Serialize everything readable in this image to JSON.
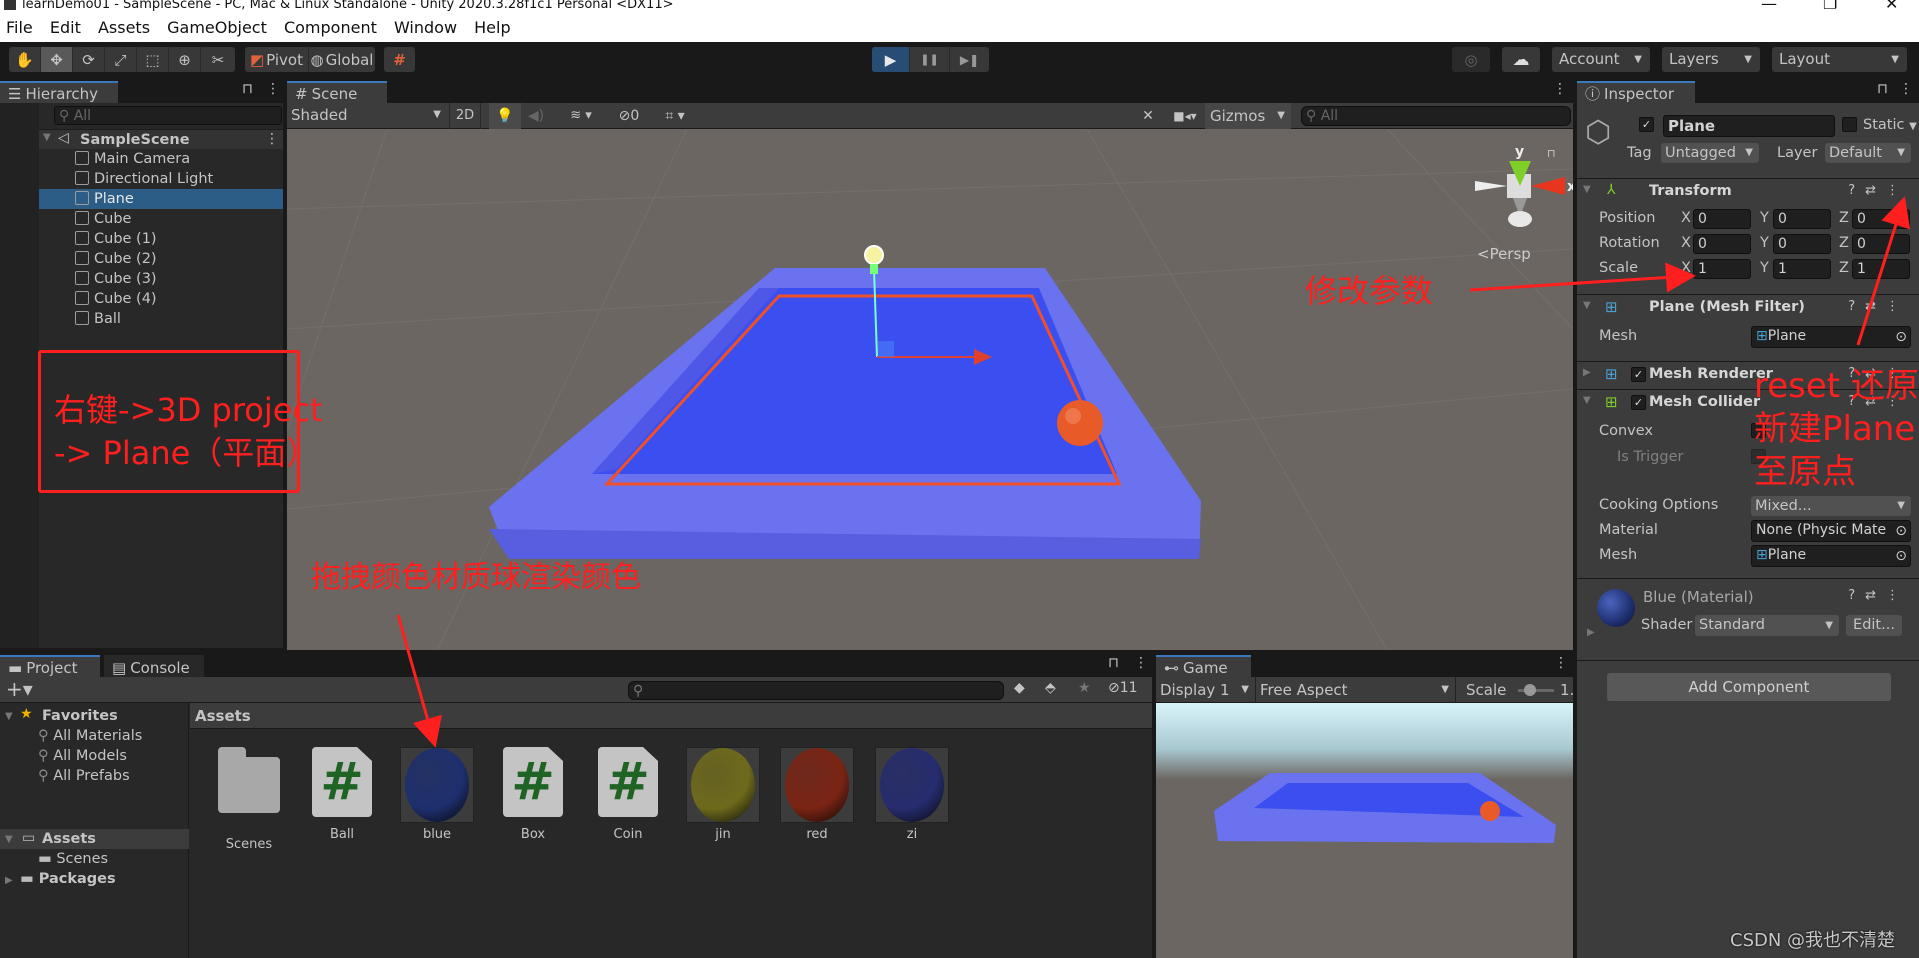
{
  "window": {
    "title": "learnDemo01 - SampleScene - PC, Mac & Linux Standalone - Unity 2020.3.28f1c1 Personal <DX11>",
    "controls": {
      "minimize": "—",
      "maximize": "❐",
      "close": "✕"
    }
  },
  "menu": [
    "File",
    "Edit",
    "Assets",
    "GameObject",
    "Component",
    "Window",
    "Help"
  ],
  "toolbar": {
    "tools": [
      {
        "name": "hand-tool",
        "glyph": "✋"
      },
      {
        "name": "move-tool",
        "glyph": "✥",
        "active": true
      },
      {
        "name": "rotate-tool",
        "glyph": "⟳"
      },
      {
        "name": "scale-tool",
        "glyph": "⤢"
      },
      {
        "name": "rect-tool",
        "glyph": "⬚"
      },
      {
        "name": "transform-tool",
        "glyph": "⊕"
      },
      {
        "name": "custom-tool",
        "glyph": "✂"
      }
    ],
    "pivot": "Pivot",
    "global": "Global",
    "snap_glyph": "#",
    "play": "▶",
    "pause": "❚❚",
    "step": "▶❚",
    "collab_glyph": "◎",
    "cloud_glyph": "☁",
    "account": "Account",
    "layers": "Layers",
    "layout": "Layout"
  },
  "hierarchy": {
    "tab": "Hierarchy",
    "search_placeholder": "All",
    "scene": "SampleScene",
    "items": [
      "Main Camera",
      "Directional Light",
      "Plane",
      "Cube",
      "Cube (1)",
      "Cube (2)",
      "Cube (3)",
      "Cube (4)",
      "Ball"
    ],
    "selected": "Plane"
  },
  "scene": {
    "tab": "Scene",
    "shading": "Shaded",
    "mode2d": "2D",
    "hidden_count": "0",
    "gizmos": "Gizmos",
    "search_placeholder": "All",
    "persp": "<Persp",
    "axis_x": "x",
    "axis_y": "y"
  },
  "inspector": {
    "tab": "Inspector",
    "object_name": "Plane",
    "static": "Static",
    "tag_label": "Tag",
    "tag": "Untagged",
    "layer_label": "Layer",
    "layer": "Default",
    "transform": {
      "title": "Transform",
      "rows": [
        {
          "label": "Position",
          "x": "0",
          "y": "0",
          "z": "0"
        },
        {
          "label": "Rotation",
          "x": "0",
          "y": "0",
          "z": "0"
        },
        {
          "label": "Scale",
          "x": "1",
          "y": "1",
          "z": "1"
        }
      ]
    },
    "mesh_filter": {
      "title": "Plane (Mesh Filter)",
      "mesh_label": "Mesh",
      "mesh": "Plane"
    },
    "mesh_renderer": {
      "title": "Mesh Renderer"
    },
    "mesh_collider": {
      "title": "Mesh Collider",
      "convex": "Convex",
      "is_trigger": "Is Trigger",
      "cooking_label": "Cooking Options",
      "cooking": "Mixed...",
      "material_label": "Material",
      "material": "None (Physic Mate",
      "mesh_label": "Mesh",
      "mesh": "Plane"
    },
    "material": {
      "title": "Blue (Material)",
      "shader_label": "Shader",
      "shader": "Standard",
      "edit": "Edit..."
    },
    "add_component": "Add Component"
  },
  "project": {
    "tab_project": "Project",
    "tab_console": "Console",
    "favorites": "Favorites",
    "fav_items": [
      "All Materials",
      "All Models",
      "All Prefabs"
    ],
    "assets": "Assets",
    "scenes": "Scenes",
    "packages": "Packages",
    "breadcrumb": "Assets",
    "hidden_count": "11",
    "items": [
      {
        "name": "Scenes",
        "type": "folder"
      },
      {
        "name": "Ball",
        "type": "script"
      },
      {
        "name": "blue",
        "type": "material",
        "color": "#1e2f6e"
      },
      {
        "name": "Box",
        "type": "script"
      },
      {
        "name": "Coin",
        "type": "script"
      },
      {
        "name": "jin",
        "type": "material",
        "color": "#6e6a1c"
      },
      {
        "name": "red",
        "type": "material",
        "color": "#7a2414"
      },
      {
        "name": "zi",
        "type": "material",
        "color": "#262c6e"
      }
    ]
  },
  "game": {
    "tab": "Game",
    "display": "Display 1",
    "aspect": "Free Aspect",
    "scale_label": "Scale",
    "scale_value": "1."
  },
  "annotations": {
    "right_click": "右键->3D project",
    "right_click_2": "-> Plane（平面）",
    "drag_material": "拖拽颜色材质球渲染颜色",
    "modify_params": "修改参数",
    "reset_1": "reset 还原",
    "reset_2": "新建Plane",
    "reset_3": "至原点"
  },
  "watermark": "CSDN @我也不清楚",
  "colors": {
    "annotation_red": "#ff1f1f",
    "selection_blue": "#2c5d87",
    "play_active": "#284d75",
    "plane_blue": "#3b4ff0",
    "wall_blue": "#6a72f0"
  }
}
